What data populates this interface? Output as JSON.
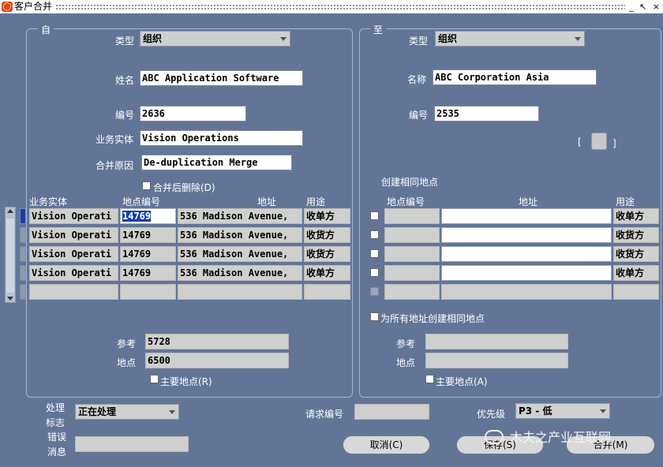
{
  "window": {
    "title": "客户合并",
    "controls": "_ ↖ ×"
  },
  "from": {
    "group_label": "自",
    "type_label": "类型",
    "type_value": "组织",
    "name_label": "姓名",
    "name_value": "ABC Application Software",
    "number_label": "编号",
    "number_value": "2636",
    "ou_label": "业务实体",
    "ou_value": "Vision Operations",
    "reason_label": "合并原因",
    "reason_value": "De-duplication Merge",
    "delete_after_label": "合并后删除(D)",
    "table": {
      "headers": [
        "业务实体",
        "地点编号",
        "地址",
        "用途"
      ],
      "rows": [
        [
          "Vision Operati",
          "14769",
          "536 Madison Avenue,",
          "收单方"
        ],
        [
          "Vision Operati",
          "14769",
          "536 Madison Avenue,",
          "收货方"
        ],
        [
          "Vision Operati",
          "14769",
          "536 Madison Avenue,",
          "收货方"
        ],
        [
          "Vision Operati",
          "14769",
          "536 Madison Avenue,",
          "收单方"
        ],
        [
          "",
          "",
          "",
          ""
        ]
      ]
    },
    "reference_label": "参考",
    "reference_value": "5728",
    "site_label": "地点",
    "site_value": "6500",
    "primary_site_label": "主要地点(R)"
  },
  "to": {
    "group_label": "至",
    "type_label": "类型",
    "type_value": "组织",
    "name_label": "名称",
    "name_value": "ABC Corporation Asia",
    "number_label": "编号",
    "number_value": "2535",
    "bracket_left": "[",
    "bracket_right": "]",
    "create_same_site_label": "创建相同地点",
    "table": {
      "headers": [
        "地点编号",
        "地址",
        "用途"
      ],
      "rows": [
        [
          "",
          "",
          "收单方"
        ],
        [
          "",
          "",
          "收货方"
        ],
        [
          "",
          "",
          "收货方"
        ],
        [
          "",
          "",
          "收单方"
        ],
        [
          "",
          "",
          ""
        ]
      ]
    },
    "create_all_label": "为所有地址创建相同地点",
    "reference_label": "参考",
    "site_label": "地点",
    "primary_site_label": "主要地点(A)"
  },
  "footer": {
    "process_flag_label_1": "处理",
    "process_flag_label_2": "标志",
    "process_flag_value": "正在处理",
    "error_label_1": "错误",
    "error_label_2": "消息",
    "request_no_label": "请求编号",
    "priority_label": "优先级",
    "priority_value": "P3 - 低",
    "cancel_label": "取消(C)",
    "save_label": "保存(S)",
    "merge_label": "合并(M)"
  },
  "watermark": "木夫之产业互联网"
}
